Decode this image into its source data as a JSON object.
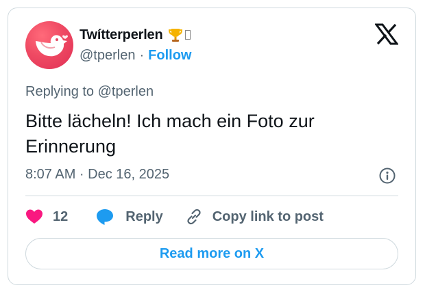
{
  "author": {
    "display_name": "Twítterperlen",
    "handle": "@tperlen",
    "separator": "·",
    "follow_label": "Follow"
  },
  "tweet": {
    "reply_context": "Replying to @tperlen",
    "text": "Bitte lächeln! Ich mach ein Foto zur Erinnerung",
    "timestamp": "8:07 AM · Dec 16, 2025"
  },
  "actions": {
    "like_count": "12",
    "reply_label": "Reply",
    "copy_link_label": "Copy link to post"
  },
  "footer": {
    "read_more_label": "Read more on X"
  },
  "icons": {
    "avatar": "bird-avatar",
    "badge": "trophy-icon",
    "brand": "x-logo-icon",
    "info": "info-icon",
    "like": "heart-icon",
    "reply": "speech-bubble-icon",
    "copy_link": "link-icon"
  },
  "colors": {
    "accent": "#1d9bf0",
    "like": "#f91880",
    "secondary_text": "#536471",
    "border": "#cfd9de",
    "avatar": "#ef4a63"
  }
}
